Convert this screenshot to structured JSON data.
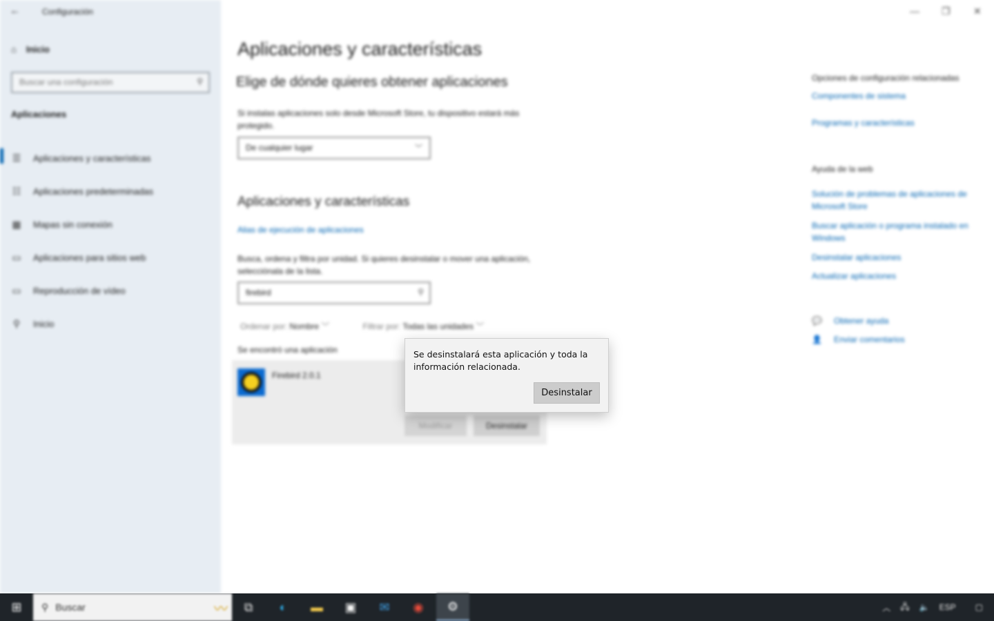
{
  "window": {
    "title": "Configuración"
  },
  "sidebar": {
    "home_label": "Inicio",
    "search_placeholder": "Buscar una configuración",
    "section": "Aplicaciones",
    "items": [
      {
        "label": "Aplicaciones y características",
        "icon": "list-icon",
        "active": true
      },
      {
        "label": "Aplicaciones predeterminadas",
        "icon": "defaults-icon",
        "active": false
      },
      {
        "label": "Mapas sin conexión",
        "icon": "map-icon",
        "active": false
      },
      {
        "label": "Aplicaciones para sitios web",
        "icon": "web-icon",
        "active": false
      },
      {
        "label": "Reproducción de vídeo",
        "icon": "video-icon",
        "active": false
      },
      {
        "label": "Inicio",
        "icon": "startup-icon",
        "active": false
      }
    ]
  },
  "main": {
    "title": "Aplicaciones y características",
    "source_heading": "Elige de dónde quieres obtener aplicaciones",
    "source_desc": "Si instalas aplicaciones solo desde Microsoft Store, tu dispositivo estará más protegido.",
    "source_select": "De cualquier lugar",
    "apps_heading": "Aplicaciones y características",
    "alias_link": "Alias de ejecución de aplicaciones",
    "apps_desc": "Busca, ordena y filtra por unidad. Si quieres desinstalar o mover una aplicación, selecciónala de la lista.",
    "filter_value": "firebird",
    "sort_label": "Ordenar por:",
    "sort_value": "Nombre",
    "filter_label": "Filtrar por:",
    "filter_drive": "Todas las unidades",
    "found_text": "Se encontró una aplicación",
    "app": {
      "name": "Firebird 2.0.1",
      "modify": "Modificar",
      "uninstall": "Desinstalar"
    }
  },
  "right": {
    "related_heading": "Opciones de configuración relacionadas",
    "related_links": [
      "Componentes de sistema",
      "Programas y características"
    ],
    "help_heading": "Ayuda de la web",
    "help_links": [
      "Solución de problemas de aplicaciones de Microsoft Store",
      "Buscar aplicación o programa instalado en Windows",
      "Desinstalar aplicaciones",
      "Actualizar aplicaciones"
    ],
    "get_help": "Obtener ayuda",
    "feedback": "Enviar comentarios"
  },
  "dialog": {
    "message": "Se desinstalará esta aplicación y toda la información relacionada.",
    "button": "Desinstalar"
  },
  "taskbar": {
    "search_placeholder": "Buscar",
    "language": "ESP"
  }
}
